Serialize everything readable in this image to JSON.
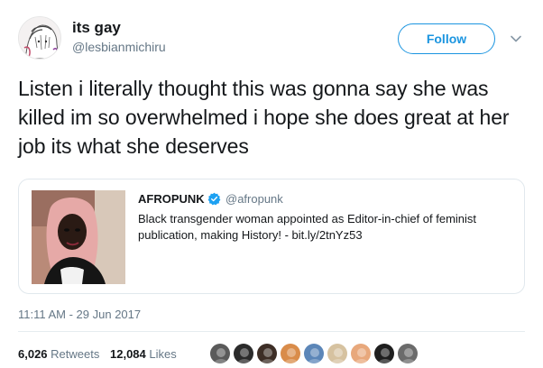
{
  "author": {
    "name": "its gay",
    "handle": "@lesbianmichiru",
    "avatar_icon": "anime-sketch-avatar"
  },
  "follow": {
    "label": "Follow",
    "accent": "#1b95e0"
  },
  "more_icon": "chevron-down-icon",
  "tweet": {
    "text": "Listen i literally thought this was gonna say she was killed im so overwhelmed i hope she does great at her job its what she deserves"
  },
  "quoted": {
    "name": "AFROPUNK",
    "verified": true,
    "handle": "@afropunk",
    "text": "Black transgender woman appointed as Editor-in-chief of feminist publication, making History! - bit.ly/2tnYz53",
    "photo_icon": "portrait-photo"
  },
  "timestamp": "11:11 AM - 29 Jun 2017",
  "stats": {
    "retweets_count": "6,026",
    "retweets_label": "Retweets",
    "likes_count": "12,084",
    "likes_label": "Likes"
  },
  "likers": [
    {
      "icon": "liker-avatar-1",
      "color": "#5a5a5a"
    },
    {
      "icon": "liker-avatar-2",
      "color": "#2b2b2b"
    },
    {
      "icon": "liker-avatar-3",
      "color": "#3d2e26"
    },
    {
      "icon": "liker-avatar-4",
      "color": "#d98c4a"
    },
    {
      "icon": "liker-avatar-5",
      "color": "#5c86b8"
    },
    {
      "icon": "liker-avatar-6",
      "color": "#d6c2a0"
    },
    {
      "icon": "liker-avatar-7",
      "color": "#e8a87c"
    },
    {
      "icon": "liker-avatar-8",
      "color": "#1f1f1f"
    },
    {
      "icon": "liker-avatar-9",
      "color": "#6b6b6b"
    }
  ]
}
